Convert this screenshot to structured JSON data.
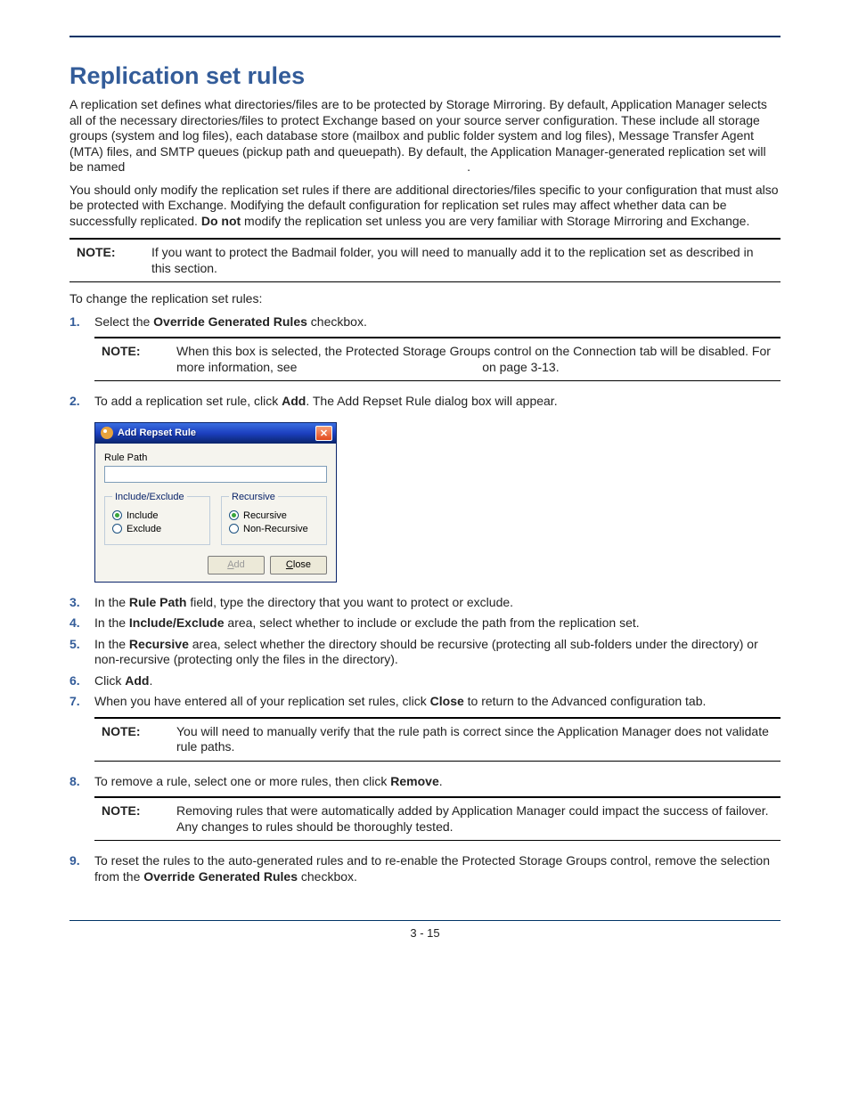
{
  "page": {
    "title": "Replication set rules",
    "footer": "3 - 15"
  },
  "paras": {
    "p1": "A replication set defines what directories/files are to be protected by Storage Mirroring. By default, Application Manager selects all of the necessary directories/files to protect Exchange based on your source server configuration. These include all storage groups (system and log files), each database store (mailbox and public folder system and log files), Message Transfer Agent (MTA) files, and SMTP queues (pickup path and queuepath). By default, the Application Manager-generated replication set will be named",
    "p1_trail": ".",
    "p2a": "You should only modify the replication set rules if there are additional directories/files specific to your configuration that must also be protected with Exchange. Modifying the default configuration for replication set rules may affect whether data can be successfully replicated. ",
    "p2b": "Do not",
    "p2c": " modify the replication set unless you are very familiar with Storage Mirroring and Exchange.",
    "intro": "To change the replication set rules:"
  },
  "notes": {
    "label": "NOTE:",
    "n1": "If you want to protect the Badmail folder, you will need to manually add it to the replication set as described in this section.",
    "n2a": "When this box is selected, the Protected Storage Groups control on the Connection tab will be disabled. For more information, see",
    "n2b": " on page 3-13.",
    "n3": "You will need to manually verify that the rule path is correct since the Application Manager does not validate rule paths.",
    "n4": "Removing rules that were automatically added by Application Manager could impact the success of failover. Any changes to rules should be thoroughly tested."
  },
  "steps": {
    "s1a": "Select the ",
    "s1b": "Override Generated Rules",
    "s1c": " checkbox.",
    "s2a": "To add a replication set rule, click ",
    "s2b": "Add",
    "s2c": ". The Add Repset Rule dialog box will appear.",
    "s3a": "In the ",
    "s3b": "Rule Path",
    "s3c": " field, type the directory that you want to protect or exclude.",
    "s4a": "In the ",
    "s4b": "Include/Exclude",
    "s4c": " area, select whether to include or exclude the path from the replication set.",
    "s5a": "In the ",
    "s5b": "Recursive",
    "s5c": " area, select whether the directory should be recursive (protecting all sub-folders under the directory) or non-recursive (protecting only the files in the directory).",
    "s6a": "Click ",
    "s6b": "Add",
    "s6c": ".",
    "s7a": "When you have entered all of your replication set rules, click ",
    "s7b": "Close",
    "s7c": " to return to the Advanced configuration tab.",
    "s8a": "To remove a rule, select one or more rules, then click ",
    "s8b": "Remove",
    "s8c": ".",
    "s9a": "To reset the rules to the auto-generated rules and to re-enable the Protected Storage Groups control, remove the selection from the ",
    "s9b": "Override Generated Rules",
    "s9c": " checkbox."
  },
  "dialog": {
    "title": "Add Repset Rule",
    "rule_path_label": "Rule Path",
    "rule_path_value": "",
    "group_ie": "Include/Exclude",
    "opt_include": "Include",
    "opt_exclude": "Exclude",
    "group_rec": "Recursive",
    "opt_recursive": "Recursive",
    "opt_nonrecursive": "Non-Recursive",
    "btn_add_u": "A",
    "btn_add_rest": "dd",
    "btn_close_u": "C",
    "btn_close_rest": "lose",
    "close_x": "✕"
  },
  "nums": {
    "n1": "1.",
    "n2": "2.",
    "n3": "3.",
    "n4": "4.",
    "n5": "5.",
    "n6": "6.",
    "n7": "7.",
    "n8": "8.",
    "n9": "9."
  }
}
